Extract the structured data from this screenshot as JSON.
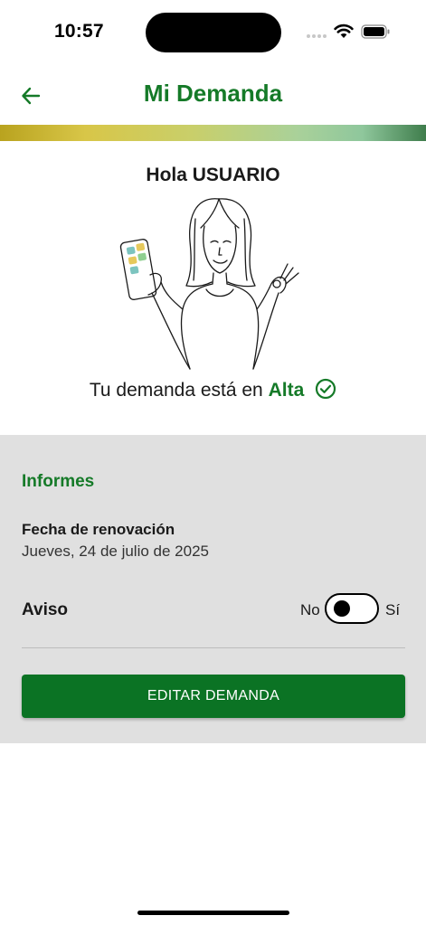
{
  "status_bar": {
    "time": "10:57",
    "icons": [
      "cellular-signal-icon",
      "wifi-icon",
      "battery-icon"
    ]
  },
  "header": {
    "title": "Mi Demanda",
    "back_icon": "arrow-left-icon"
  },
  "profile": {
    "greeting": "Hola USUARIO",
    "status_prefix": "Tu demanda está en",
    "status_value": "Alta",
    "status_icon": "check-circle-icon"
  },
  "reports": {
    "section_title": "Informes",
    "renewal_label": "Fecha de renovación",
    "renewal_date": "Jueves, 24 de julio de 2025",
    "notice_label": "Aviso",
    "toggle_off_label": "No",
    "toggle_on_label": "Sí",
    "toggle_state": "No",
    "edit_button": "EDITAR DEMANDA"
  },
  "colors": {
    "brand_green": "#157a28",
    "button_green": "#0b7324",
    "panel_gray": "#e0e0e0"
  }
}
